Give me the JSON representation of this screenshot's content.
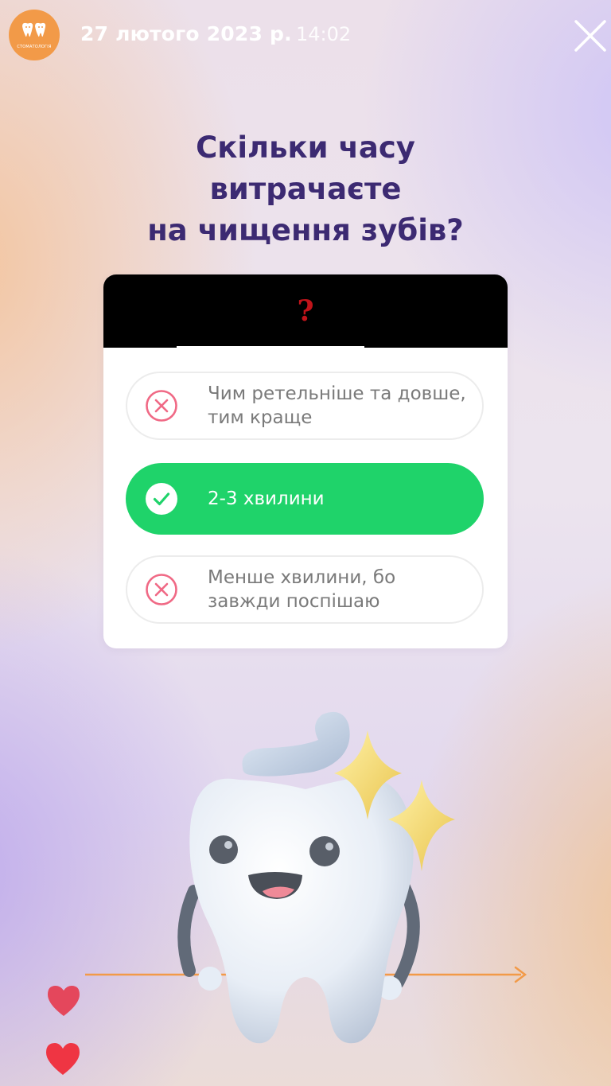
{
  "header": {
    "date": "27 лютого 2023 р.",
    "time": "14:02",
    "avatar_icon": "clinic-logo-icon",
    "avatar_text": "СТОМАТОЛОГІЯ",
    "close_icon": "close-icon"
  },
  "quiz": {
    "question_lines": [
      "Скільки часу",
      "витрачаєте",
      "на чищення зубів?"
    ],
    "header_mark": "?",
    "options": [
      {
        "label": "Чим ретельніше та довше, тим краще",
        "state": "wrong",
        "icon": "x-circle-icon"
      },
      {
        "label": "2-3 хвилини",
        "state": "correct",
        "icon": "check-circle-icon"
      },
      {
        "label": "Менше хвилини, бо завжди поспішаю",
        "state": "wrong",
        "icon": "x-circle-icon"
      }
    ]
  },
  "illustration": {
    "icon": "tooth-mascot-icon",
    "sparkle_icon": "sparkle-icon",
    "arrow_icon": "arrow-right-icon"
  },
  "reactions": [
    {
      "icon": "heart-icon",
      "color": "#e4475c"
    },
    {
      "icon": "heart-icon",
      "color": "#ef3543"
    }
  ],
  "colors": {
    "accent_correct": "#1fd36a",
    "wrong_icon": "#f06985",
    "question_text": "#3c2a72",
    "avatar_bg": "#f29a48",
    "arrow": "#f29a48"
  }
}
